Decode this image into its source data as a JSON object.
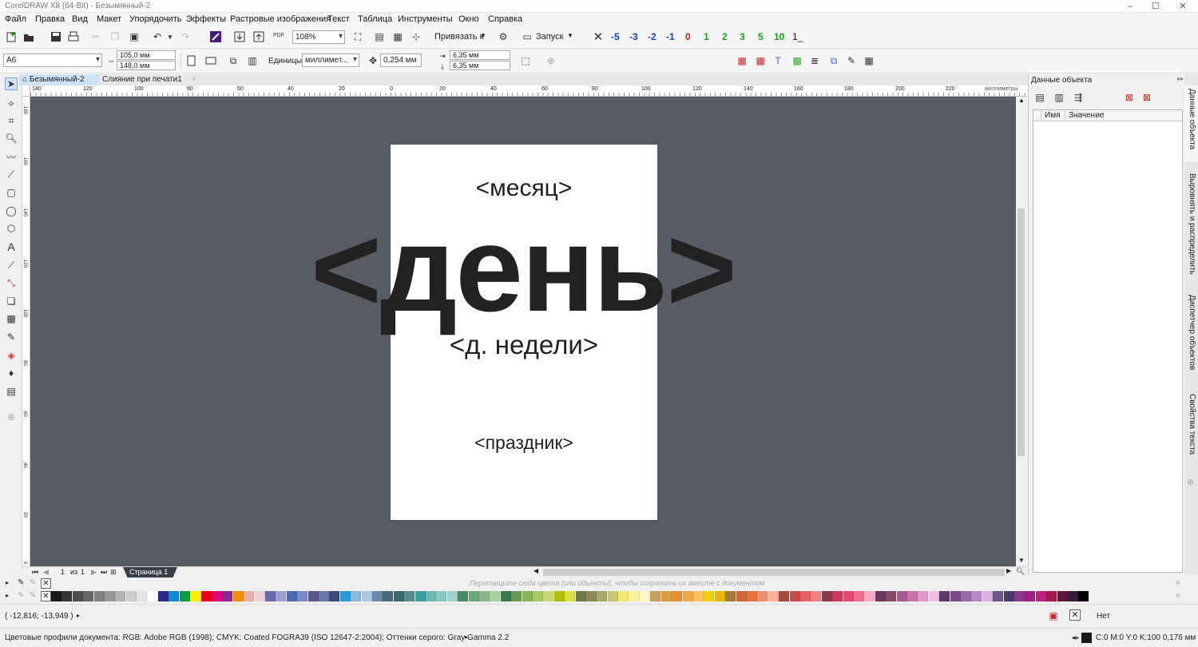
{
  "title": "CorelDRAW X8 (64-Bit) - Безымянный-2",
  "menu": [
    "Файл",
    "Правка",
    "Вид",
    "Макет",
    "Упорядочить",
    "Эффекты",
    "Растровые изображения",
    "Текст",
    "Таблица",
    "Инструменты",
    "Окно",
    "Справка"
  ],
  "toolbar": {
    "zoom": "108%",
    "snap_label": "Привязать к",
    "launch_label": "Запуск",
    "pdf_label": "PDF",
    "nudge_values": [
      "-5",
      "-3",
      "-2",
      "-1",
      "0",
      "1",
      "2",
      "3",
      "5",
      "10"
    ],
    "nudge_colors": [
      "#1a3ec8",
      "#1a3ec8",
      "#1a3ec8",
      "#1a3ec8",
      "#d21a1a",
      "#20a020",
      "#20a020",
      "#20a020",
      "#20a020",
      "#20a020"
    ],
    "nudge_suffix": "1_"
  },
  "propbar": {
    "paper_size": "A6",
    "width": "105,0 мм",
    "height": "148,0 мм",
    "units_label": "Единицы:",
    "units_value": "миллимет...",
    "nudge": "0,254 мм",
    "dup_x": "6,35 мм",
    "dup_y": "6,35 мм"
  },
  "doc_tabs": [
    "Безымянный-2",
    "Слияние при печати1"
  ],
  "ruler": {
    "h_labels": [
      "140",
      "120",
      "100",
      "80",
      "60",
      "40",
      "20",
      "0",
      "20",
      "40",
      "60",
      "80",
      "100",
      "120",
      "140",
      "160",
      "180",
      "200",
      "220"
    ],
    "unit": "миллиметры",
    "v_labels": [
      "180",
      "160",
      "140",
      "120",
      "100",
      "80",
      "60",
      "40",
      "20",
      "0"
    ]
  },
  "page_text": {
    "month": "<месяц>",
    "day": "<день>",
    "weekday": "<д. недели>",
    "holiday": "<праздник>"
  },
  "page_nav": {
    "current": "1",
    "of": "из",
    "total": "1",
    "page_tab": "Страница 1"
  },
  "docker": {
    "title": "Данные объекта",
    "col_name": "Имя",
    "col_value": "Значение",
    "side_tabs": [
      "Данные объекта",
      "Выровнять и распределить",
      "Диспетчер объектов",
      "Свойства текста"
    ]
  },
  "palette_hint": "Перетащите сюда цвета (или объекты), чтобы сохранить их вместе с документом",
  "palette_colors": [
    "#1a1a1a",
    "#333333",
    "#4d4d4d",
    "#666666",
    "#808080",
    "#999999",
    "#b3b3b3",
    "#cccccc",
    "#e6e6e6",
    "#ffffff",
    "#2a2a8a",
    "#0d8ad6",
    "#00a04a",
    "#fff200",
    "#e8001c",
    "#e4007c",
    "#8a2a8a",
    "#f28c00",
    "#e6b0b0",
    "#f0d0d0",
    "#6a6aa8",
    "#9aa0d0",
    "#4a6ab0",
    "#7a8ac8",
    "#5a5a8a",
    "#6a78a8",
    "#3a4a78",
    "#2a9ad6",
    "#8ab8d8",
    "#a8c8e0",
    "#6a8aa8",
    "#4a6a7a",
    "#3a6a6a",
    "#5a8a8a",
    "#3aa0a0",
    "#6ab8b0",
    "#8ac8c0",
    "#a0d0c8",
    "#4a8a6a",
    "#6aa87a",
    "#8ab88a",
    "#a8d0a0",
    "#3a7a4a",
    "#6a9a5a",
    "#8ab05a",
    "#a8c868",
    "#c8d878",
    "#b0c000",
    "#d8e040",
    "#6a7a4a",
    "#8a8a5a",
    "#a8a868",
    "#c8c870",
    "#f0e870",
    "#f8f0a0",
    "#fff8c8",
    "#c8a060",
    "#d8a040",
    "#e89030",
    "#f0a848",
    "#f8c060",
    "#f0d000",
    "#e8b800",
    "#a87a3a",
    "#c86a3a",
    "#e8703a",
    "#f09070",
    "#f8b098",
    "#a84a3a",
    "#c84a4a",
    "#e86060",
    "#f08080",
    "#8a3a4a",
    "#c83a5a",
    "#e04a70",
    "#f07090",
    "#f8a8c0",
    "#6a3a5a",
    "#8a4a6a",
    "#a85a8a",
    "#c870a8",
    "#e098c8",
    "#f0c0e0",
    "#5a3a6a",
    "#7a4a8a",
    "#986aa8",
    "#b888c8",
    "#d8b0e0",
    "#6a5a8a",
    "#4a3a6a",
    "#8a3a8a",
    "#a0208a",
    "#c02080",
    "#a01a4a",
    "#5a1a3a",
    "#3a1a3a",
    "#000000"
  ],
  "status": {
    "coords": "( -12,816; -13,949 )",
    "fill_none": "Нет",
    "color_profiles": "Цветовые профили документа: RGB: Adobe RGB (1998); CMYK: Coated FOGRA39 (ISO 12647-2:2004); Оттенки серого: Gray Gamma 2.2",
    "outline_info": "C:0 M:0 Y:0 K:100  0,176 мм"
  },
  "icons": [
    "new-icon",
    "open-icon",
    "save-icon",
    "print-icon",
    "undo-icon",
    "redo-icon",
    "import-icon",
    "export-icon",
    "gear-icon",
    "pick-tool-icon",
    "shape-tool-icon",
    "crop-icon",
    "zoom-icon",
    "freehand-icon",
    "smart-fill-icon",
    "rectangle-icon",
    "ellipse-icon",
    "polygon-icon",
    "text-icon",
    "line-icon",
    "connector-icon",
    "shadow-icon",
    "transparency-icon",
    "eyedropper-icon",
    "interactive-fill-icon",
    "smart-fill-tool-icon",
    "mesh-icon",
    "add-icon"
  ]
}
